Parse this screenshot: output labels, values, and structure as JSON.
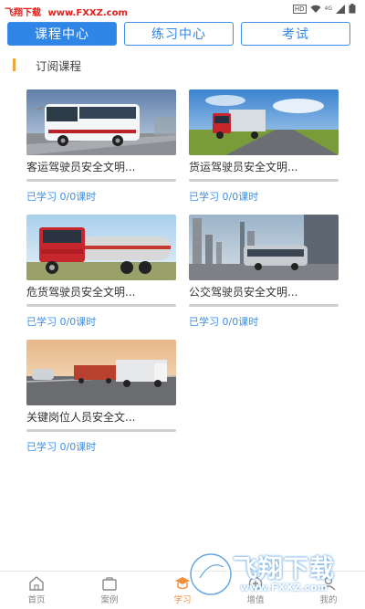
{
  "watermark": {
    "site_name": "飞翔下载",
    "site_url": "www.FXXZ.com",
    "big_text": "飞翔下载",
    "big_url": "www.FXXZ.com"
  },
  "statusbar": {
    "hd": "HD",
    "net": "4G"
  },
  "tabs": [
    {
      "label": "课程中心",
      "active": true
    },
    {
      "label": "练习中心",
      "active": false
    },
    {
      "label": "考试",
      "active": false
    }
  ],
  "section": {
    "title": "订阅课程",
    "accent": "#f2a23a"
  },
  "courses": [
    {
      "title": "客运驾驶员安全文明...",
      "studied": "已学习 0/0课时",
      "image": "bus"
    },
    {
      "title": "货运驾驶员安全文明...",
      "studied": "已学习 0/0课时",
      "image": "cargo-truck"
    },
    {
      "title": "危货驾驶员安全文明...",
      "studied": "已学习 0/0课时",
      "image": "tanker-truck"
    },
    {
      "title": "公交驾驶员安全文明...",
      "studied": "已学习 0/0课时",
      "image": "city-bus"
    },
    {
      "title": "关键岗位人员安全文...",
      "studied": "已学习 0/0课时",
      "image": "trucks-highway"
    }
  ],
  "nav": [
    {
      "label": "首页",
      "icon": "home-icon"
    },
    {
      "label": "案例",
      "icon": "case-icon"
    },
    {
      "label": "学习",
      "icon": "study-icon",
      "active": true
    },
    {
      "label": "增值",
      "icon": "value-icon"
    },
    {
      "label": "我的",
      "icon": "profile-icon"
    }
  ],
  "colors": {
    "primary": "#2f86e6",
    "accent": "#f0903a",
    "link": "#3b8fe6"
  }
}
